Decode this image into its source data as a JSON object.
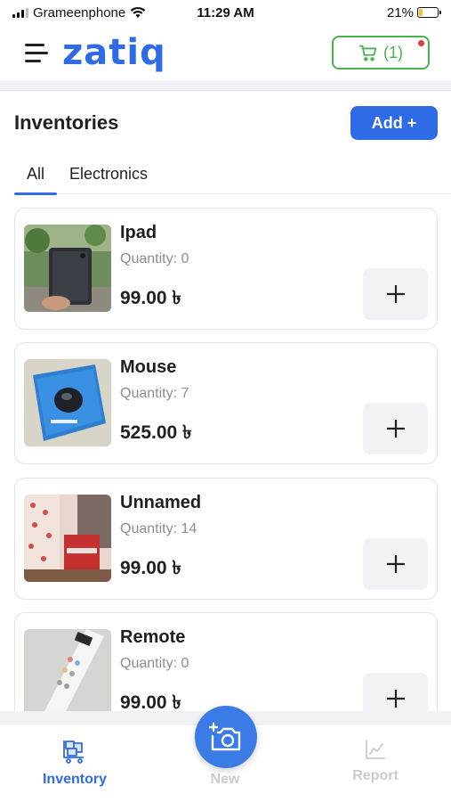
{
  "status_bar": {
    "carrier": "Grameenphone",
    "time": "11:29 AM",
    "battery_percent": "21%",
    "battery_level": 0.21
  },
  "header": {
    "logo": "zatiq",
    "cart_label": "(1)",
    "brand_color": "#2f6be6",
    "cart_color": "#4caf50"
  },
  "page": {
    "title": "Inventories",
    "add_label": "Add +"
  },
  "tabs": [
    {
      "label": "All",
      "active": true
    },
    {
      "label": "Electronics",
      "active": false
    }
  ],
  "items": [
    {
      "name": "Ipad",
      "quantity": "Quantity: 0",
      "price": "99.00 ৳",
      "image": "tablet-photo"
    },
    {
      "name": "Mouse",
      "quantity": "Quantity: 7",
      "price": "525.00 ৳",
      "image": "mouse-box-photo"
    },
    {
      "name": "Unnamed",
      "quantity": "Quantity: 14",
      "price": "99.00 ৳",
      "image": "room-photo"
    },
    {
      "name": "Remote",
      "quantity": "Quantity: 0",
      "price": "99.00 ৳",
      "image": "remote-photo"
    }
  ],
  "bottom_nav": {
    "inventory": "Inventory",
    "new": "New",
    "report": "Report",
    "active": "Inventory"
  }
}
